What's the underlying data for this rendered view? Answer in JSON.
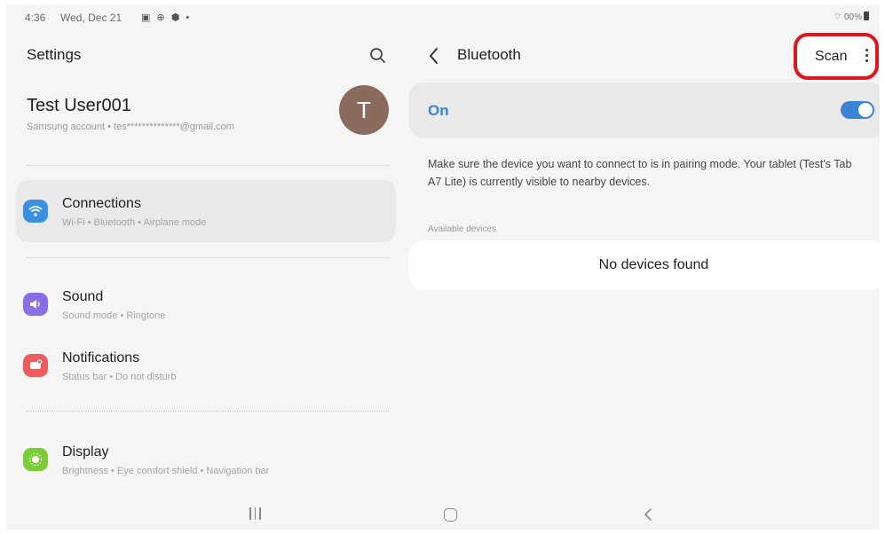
{
  "status_bar": {
    "time": "4:36",
    "date": "Wed, Dec 21",
    "notif_icons": "▣ ⊕ ⬢ •",
    "right": "⌔ 00%"
  },
  "left": {
    "title": "Settings",
    "profile": {
      "name": "Test User001",
      "sub": "Samsung account  •  tes**************@gmail.com",
      "avatar_letter": "T",
      "avatar_color": "#8b6b5d"
    },
    "items": [
      {
        "title": "Connections",
        "sub": "Wi-Fi  •  Bluetooth  •  Airplane mode",
        "icon": "wifi-icon",
        "color": "#3b8fe0",
        "active": true
      },
      {
        "title": "Sound",
        "sub": "Sound mode  •  Ringtone",
        "icon": "sound-icon",
        "color": "#8a6ee6",
        "active": false
      },
      {
        "title": "Notifications",
        "sub": "Status bar  •  Do not disturb",
        "icon": "notifications-icon",
        "color": "#ee5c5c",
        "active": false
      },
      {
        "title": "Display",
        "sub": "Brightness  •  Eye comfort shield  •  Navigation bar",
        "icon": "display-icon",
        "color": "#7ccb38",
        "active": false
      }
    ]
  },
  "right": {
    "title": "Bluetooth",
    "scan_label": "Scan",
    "on_label": "On",
    "toggle_on": true,
    "accent_color": "#3b83d4",
    "info_text": "Make sure the device you want to connect to is in pairing mode. Your tablet (Test's Tab A7 Lite) is currently visible to nearby devices.",
    "available_label": "Available devices",
    "no_devices": "No devices found",
    "highlight_color": "#e0151b"
  }
}
